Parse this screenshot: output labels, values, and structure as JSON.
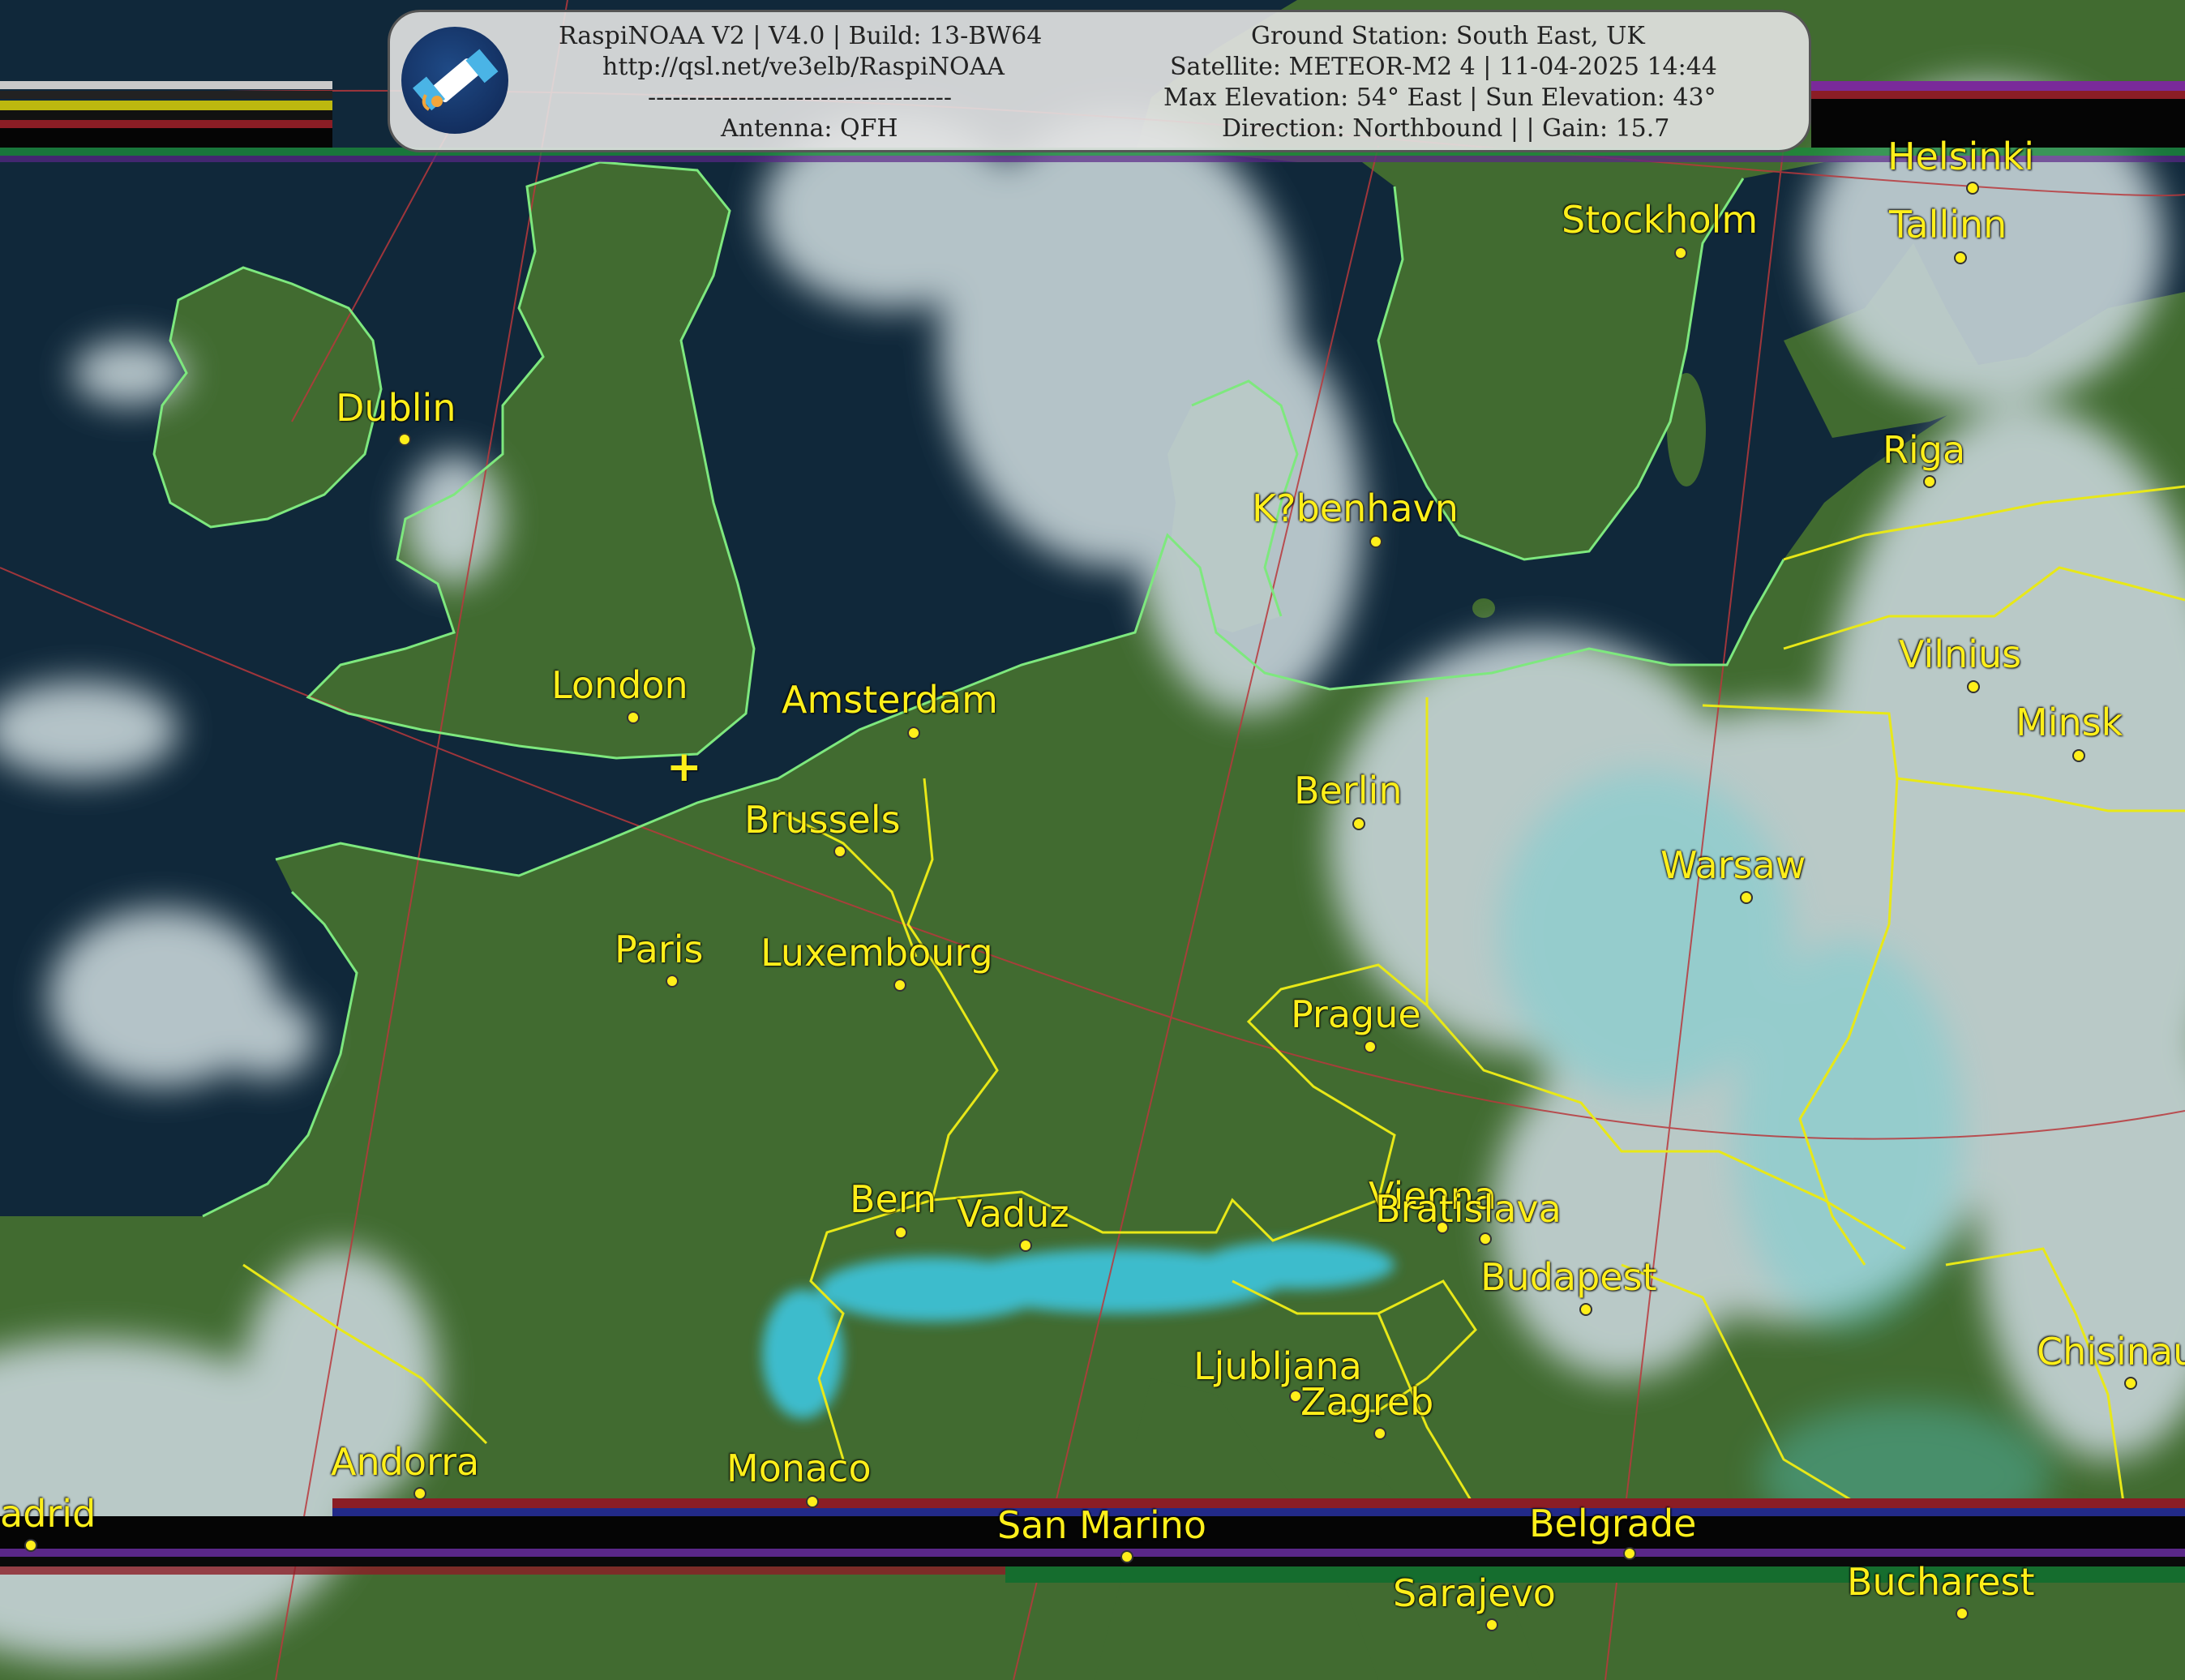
{
  "header": {
    "line_left_1": "RaspiNOAA V2 | V4.0 | Build: 13-BW64",
    "line_left_2": "http://qsl.net/ve3elb/RaspiNOAA",
    "line_left_3": "-------------------------------------",
    "line_left_4": "Antenna: QFH",
    "line_right_1": "Ground Station: South East, UK",
    "line_right_2": "Satellite: METEOR-M2 4 | 11-04-2025 14:44",
    "line_right_3": "Max Elevation: 54° East | Sun Elevation: 43°",
    "line_right_4": "Direction: Northbound | | Gain: 15.7",
    "logo_icon": "satellite-icon"
  },
  "ground_station_marker": "+",
  "colors": {
    "city_label": "#ffef1a",
    "border_line": "#e8e818",
    "coastline": "#7ee87e",
    "graticule": "#c0383a",
    "sea": "#0f2536",
    "land": "#3f6a2e",
    "cloud": "#c4d2d6",
    "snow": "#39c8e6"
  },
  "cities": [
    {
      "name": "Helsinki",
      "id": "helsinki"
    },
    {
      "name": "Stockholm",
      "id": "stockholm"
    },
    {
      "name": "Tallinn",
      "id": "tallinn"
    },
    {
      "name": "Dublin",
      "id": "dublin"
    },
    {
      "name": "Riga",
      "id": "riga"
    },
    {
      "name": "K?benhavn",
      "id": "kobenhavn"
    },
    {
      "name": "Vilnius",
      "id": "vilnius"
    },
    {
      "name": "Minsk",
      "id": "minsk"
    },
    {
      "name": "London",
      "id": "london"
    },
    {
      "name": "Amsterdam",
      "id": "amsterdam"
    },
    {
      "name": "Berlin",
      "id": "berlin"
    },
    {
      "name": "Brussels",
      "id": "brussels"
    },
    {
      "name": "Warsaw",
      "id": "warsaw"
    },
    {
      "name": "Paris",
      "id": "paris"
    },
    {
      "name": "Luxembourg",
      "id": "luxembourg"
    },
    {
      "name": "Prague",
      "id": "prague"
    },
    {
      "name": "Bern",
      "id": "bern"
    },
    {
      "name": "Vaduz",
      "id": "vaduz"
    },
    {
      "name": "Vienna",
      "id": "vienna"
    },
    {
      "name": "Bratislava",
      "id": "bratislava"
    },
    {
      "name": "Budapest",
      "id": "budapest"
    },
    {
      "name": "Ljubljana",
      "id": "ljubljana"
    },
    {
      "name": "Zagreb",
      "id": "zagreb"
    },
    {
      "name": "Chisinau",
      "id": "chisinau"
    },
    {
      "name": "Andorra",
      "id": "andorra"
    },
    {
      "name": "Monaco",
      "id": "monaco"
    },
    {
      "name": "adrid",
      "id": "madrid"
    },
    {
      "name": "San Marino",
      "id": "san-marino"
    },
    {
      "name": "Belgrade",
      "id": "belgrade"
    },
    {
      "name": "Sarajevo",
      "id": "sarajevo"
    },
    {
      "name": "Bucharest",
      "id": "bucharest"
    }
  ]
}
